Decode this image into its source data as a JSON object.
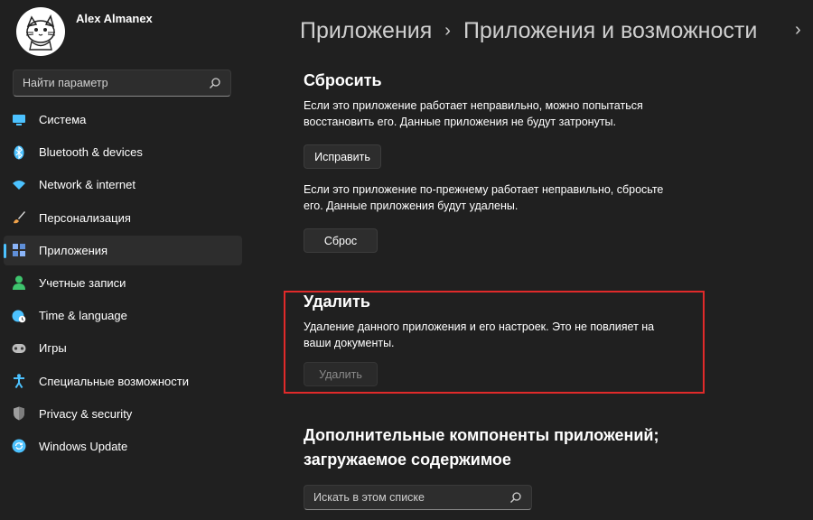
{
  "profile": {
    "name": "Alex Almanex"
  },
  "search": {
    "placeholder": "Найти параметр"
  },
  "nav": {
    "items": [
      {
        "label": "Система",
        "icon": "monitor-icon",
        "color": "#4cc2ff"
      },
      {
        "label": "Bluetooth & devices",
        "icon": "bluetooth-icon",
        "color": "#4cc2ff"
      },
      {
        "label": "Network & internet",
        "icon": "wifi-icon",
        "color": "#4cc2ff"
      },
      {
        "label": "Персонализация",
        "icon": "brush-icon",
        "color": "#f0a24a"
      },
      {
        "label": "Приложения",
        "icon": "apps-icon",
        "color": "#8ab4f8",
        "active": true
      },
      {
        "label": "Учетные записи",
        "icon": "person-icon",
        "color": "#3ec46d"
      },
      {
        "label": "Time & language",
        "icon": "globe-clock-icon",
        "color": "#4cc2ff"
      },
      {
        "label": "Игры",
        "icon": "gamepad-icon",
        "color": "#bdbdbd"
      },
      {
        "label": "Специальные возможности",
        "icon": "accessibility-icon",
        "color": "#4cc2ff"
      },
      {
        "label": "Privacy & security",
        "icon": "shield-icon",
        "color": "#9e9e9e"
      },
      {
        "label": "Windows Update",
        "icon": "update-icon",
        "color": "#4cc2ff"
      }
    ]
  },
  "breadcrumb": {
    "parent": "Приложения",
    "current": "Приложения и возможности",
    "separator": "›"
  },
  "reset": {
    "title": "Сбросить",
    "repair_desc": "Если это приложение работает неправильно, можно попытаться восстановить его. Данные приложения не будут затронуты.",
    "repair_button": "Исправить",
    "reset_desc": "Если это приложение по-прежнему работает неправильно, сбросьте его. Данные приложения будут удалены.",
    "reset_button": "Сброс"
  },
  "uninstall": {
    "title": "Удалить",
    "desc": "Удаление данного приложения и его настроек. Это не повлияет на ваши документы.",
    "button": "Удалить"
  },
  "addons": {
    "title": "Дополнительные компоненты приложений; загружаемое содержимое",
    "search_placeholder": "Искать в этом списке"
  },
  "colors": {
    "accent": "#4cc2ff",
    "highlight": "#e02a2a",
    "background": "#202020"
  }
}
